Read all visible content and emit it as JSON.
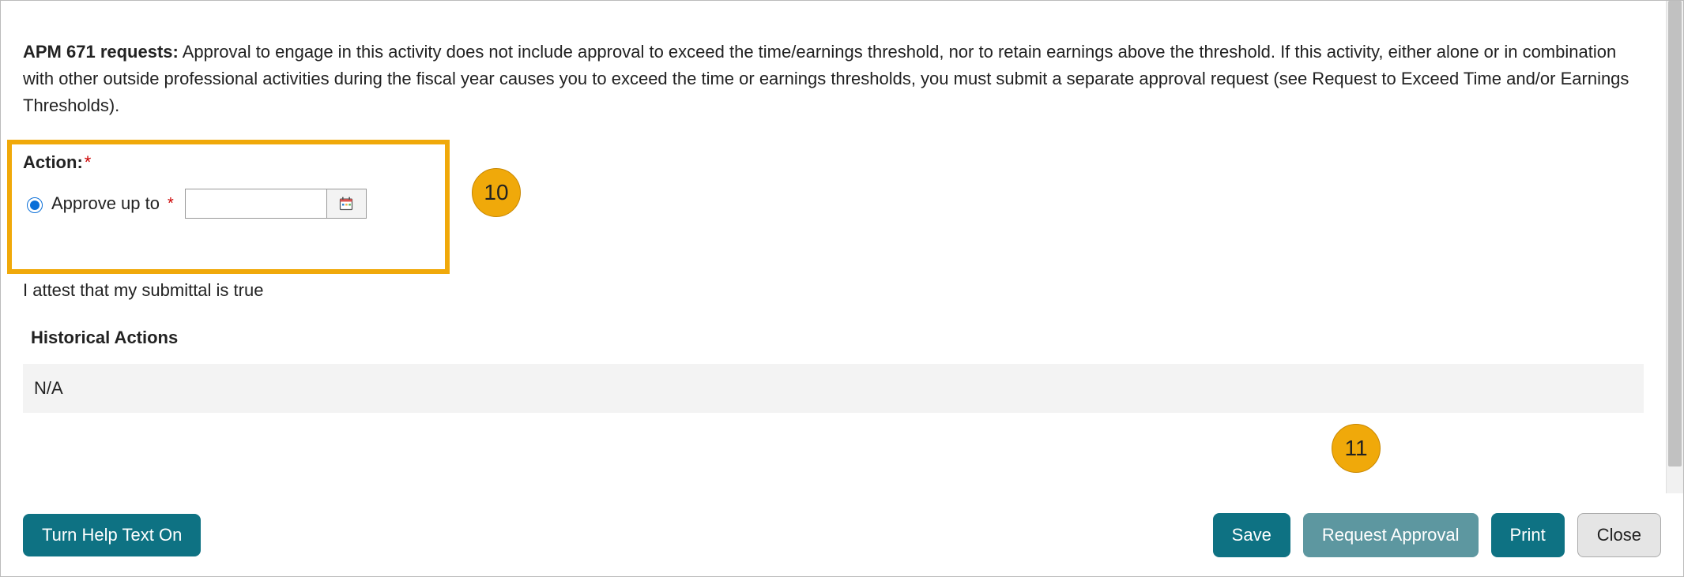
{
  "intro": {
    "bold_prefix": "APM 671 requests:",
    "text": " Approval to engage in this activity does not include approval to exceed the time/earnings threshold, nor to retain earnings above the threshold. If this activity, either alone or in combination with other outside professional activities during the fiscal year causes you to exceed the time or earnings thresholds, you must submit a separate approval request (see Request to Exceed Time and/or Earnings Thresholds)."
  },
  "action": {
    "label": "Action:",
    "required_marker": "*",
    "options": [
      {
        "label": "Approve up to",
        "checked": true
      }
    ],
    "date_value": "",
    "date_required_marker": "*"
  },
  "attest_text": "I attest that my submittal is true",
  "historical": {
    "header": "Historical Actions",
    "rows": [
      "N/A"
    ]
  },
  "footer": {
    "help_toggle": "Turn Help Text On",
    "save": "Save",
    "request_approval": "Request Approval",
    "print": "Print",
    "close": "Close"
  },
  "callouts": {
    "c10": "10",
    "c11": "11"
  }
}
